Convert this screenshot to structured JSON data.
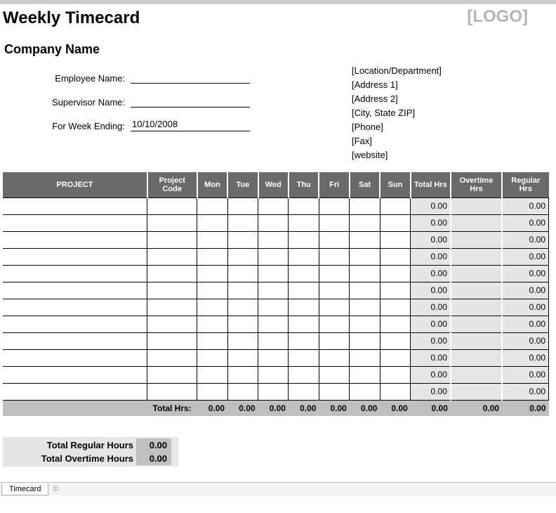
{
  "header": {
    "title": "Weekly Timecard",
    "logo": "[LOGO]",
    "company": "Company Name"
  },
  "fields": {
    "employee_label": "Employee Name:",
    "employee_value": "",
    "supervisor_label": "Supervisor Name:",
    "supervisor_value": "",
    "week_label": "For Week Ending:",
    "week_value": "10/10/2008"
  },
  "address": {
    "location": "[Location/Department]",
    "addr1": "[Address 1]",
    "addr2": "[Address 2]",
    "city": "[City, State ZIP]",
    "phone": "[Phone]",
    "fax": "[Fax]",
    "website": "[website]"
  },
  "columns": {
    "project": "PROJECT",
    "code": "Project Code",
    "mon": "Mon",
    "tue": "Tue",
    "wed": "Wed",
    "thu": "Thu",
    "fri": "Fri",
    "sat": "Sat",
    "sun": "Sun",
    "total": "Total Hrs",
    "overtime": "Overtime Hrs",
    "regular": "Regular Hrs"
  },
  "rows": [
    {
      "total": "0.00",
      "regular": "0.00"
    },
    {
      "total": "0.00",
      "regular": "0.00"
    },
    {
      "total": "0.00",
      "regular": "0.00"
    },
    {
      "total": "0.00",
      "regular": "0.00"
    },
    {
      "total": "0.00",
      "regular": "0.00"
    },
    {
      "total": "0.00",
      "regular": "0.00"
    },
    {
      "total": "0.00",
      "regular": "0.00"
    },
    {
      "total": "0.00",
      "regular": "0.00"
    },
    {
      "total": "0.00",
      "regular": "0.00"
    },
    {
      "total": "0.00",
      "regular": "0.00"
    },
    {
      "total": "0.00",
      "regular": "0.00"
    },
    {
      "total": "0.00",
      "regular": "0.00"
    }
  ],
  "totals": {
    "label": "Total Hrs:",
    "mon": "0.00",
    "tue": "0.00",
    "wed": "0.00",
    "thu": "0.00",
    "fri": "0.00",
    "sat": "0.00",
    "sun": "0.00",
    "total": "0.00",
    "overtime": "0.00",
    "regular": "0.00"
  },
  "summary": {
    "regular_label": "Total Regular Hours",
    "regular_value": "0.00",
    "overtime_label": "Total Overtime Hours",
    "overtime_value": "0.00"
  },
  "sheet": {
    "tab": "Timecard",
    "extra": "©"
  }
}
